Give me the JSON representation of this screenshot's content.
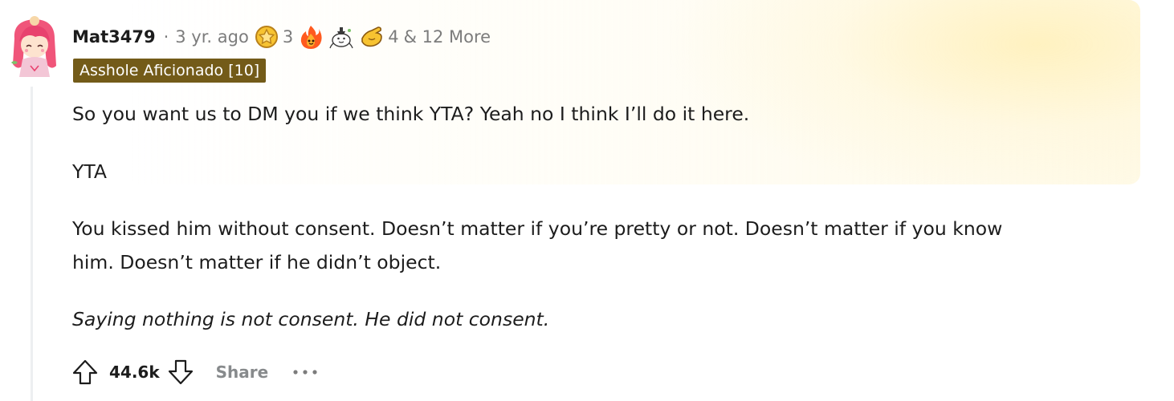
{
  "comment": {
    "username": "Mat3479",
    "separator": "·",
    "timestamp": "3 yr. ago",
    "awards": [
      {
        "icon": "gold-star-award-icon",
        "count": "3"
      },
      {
        "icon": "fire-award-icon",
        "count": ""
      },
      {
        "icon": "wholesome-seal-award-icon",
        "count": ""
      },
      {
        "icon": "pointing-hand-award-icon",
        "count": "4"
      }
    ],
    "more_awards": "& 12 More",
    "flair": "Asshole Aficionado [10]",
    "paragraphs": [
      "So you want us to DM you if we think YTA? Yeah no I think I’ll do it here.",
      "YTA",
      "You kissed him without consent. Doesn’t matter if you’re pretty or not. Doesn’t matter if you know",
      "him. Doesn’t matter if he didn’t object.",
      "Saying nothing is not consent. He did not consent."
    ],
    "score": "44.6k",
    "share_label": "Share",
    "overflow_label": "···"
  },
  "colors": {
    "flair_bg": "#735b19",
    "flair_text": "#ffffff",
    "muted": "#7c7c7c",
    "text": "#1c1c1c",
    "avatar_hair": "#f0557a",
    "award_highlight": "#fff6d6"
  }
}
